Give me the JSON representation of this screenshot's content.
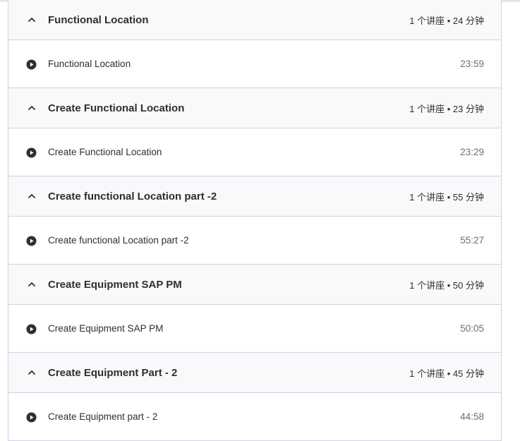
{
  "sections": [
    {
      "title": "Functional Location",
      "meta": "1 个讲座 • 24 分钟",
      "lecture": {
        "title": "Functional Location",
        "duration": "23:59"
      }
    },
    {
      "title": "Create Functional Location",
      "meta": "1 个讲座 • 23 分钟",
      "lecture": {
        "title": "Create Functional Location",
        "duration": "23:29"
      }
    },
    {
      "title": "Create functional Location part -2",
      "meta": "1 个讲座 • 55 分钟",
      "lecture": {
        "title": "Create functional Location part -2",
        "duration": "55:27"
      }
    },
    {
      "title": "Create Equipment SAP PM",
      "meta": "1 个讲座 • 50 分钟",
      "lecture": {
        "title": "Create Equipment SAP PM",
        "duration": "50:05"
      }
    },
    {
      "title": "Create Equipment Part - 2",
      "meta": "1 个讲座 • 45 分钟",
      "lecture": {
        "title": "Create Equipment part - 2",
        "duration": "44:58"
      }
    }
  ],
  "icons": {
    "section_toggle": "chevron-up-icon",
    "lecture": "play-circle-icon"
  },
  "colors": {
    "header_bg": "#f7f9fa",
    "border": "#d1d2e0",
    "text": "#2d2f31",
    "muted": "#6a6f73"
  }
}
